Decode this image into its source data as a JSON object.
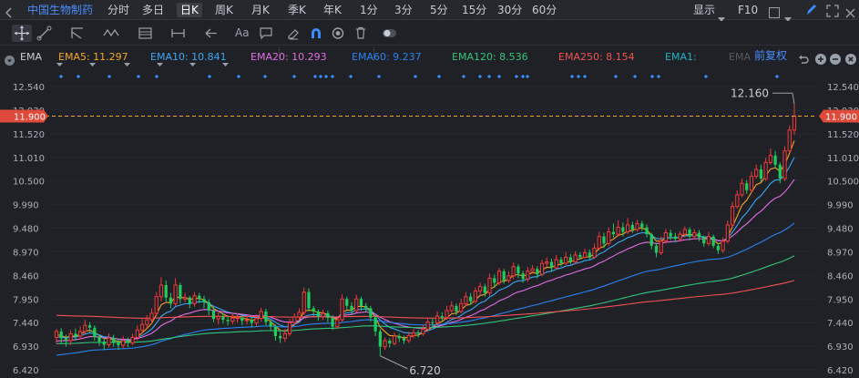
{
  "stock_name": "中国生物制药",
  "periods": [
    "分时",
    "多日",
    "日K",
    "周K",
    "月K",
    "季K",
    "年K",
    "1分",
    "3分",
    "5分",
    "15分",
    "30分",
    "60分"
  ],
  "active_period": "日K",
  "topbar_right": {
    "display_label": "显示",
    "f10_label": "F10"
  },
  "toolbar": {
    "text_label": "Aa"
  },
  "legend": {
    "indicator": "EMA",
    "items": [
      {
        "label": "EMA5: 11.297",
        "color": "#f5a623"
      },
      {
        "label": "EMA10: 10.841",
        "color": "#3ba7f2"
      },
      {
        "label": "EMA20: 10.293",
        "color": "#e26de5"
      },
      {
        "label": "EMA60: 9.237",
        "color": "#2b82f0"
      },
      {
        "label": "EMA120: 8.536",
        "color": "#33c47a"
      },
      {
        "label": "EMA250: 8.154",
        "color": "#f05252"
      },
      {
        "label": "EMA1:",
        "color": "#21b1c2"
      },
      {
        "label": "EMA",
        "color": "#555a63"
      }
    ],
    "adjust_label": "前复权"
  },
  "colors": {
    "up": "#f23a3a",
    "down": "#1fcc5c",
    "price_line": "#f5a623",
    "price_tag": "#e04a3a"
  },
  "chart_data": {
    "type": "candlestick",
    "y_axis_labels": [
      "12.540",
      "12.030",
      "11.520",
      "11.010",
      "10.500",
      "9.990",
      "9.480",
      "8.970",
      "8.460",
      "7.950",
      "7.440",
      "6.930",
      "6.420"
    ],
    "ylim": [
      6.42,
      12.54
    ],
    "current_price": "11.900",
    "annotations": {
      "high": "12.160",
      "low": "6.720"
    },
    "candles": [
      [
        7.12,
        7.25,
        6.99,
        7.3
      ],
      [
        7.25,
        7.1,
        6.98,
        7.32
      ],
      [
        7.1,
        7.05,
        6.92,
        7.18
      ],
      [
        7.05,
        7.2,
        6.95,
        7.28
      ],
      [
        7.2,
        7.15,
        7.05,
        7.31
      ],
      [
        7.15,
        7.25,
        7.08,
        7.36
      ],
      [
        7.25,
        7.38,
        7.2,
        7.5
      ],
      [
        7.38,
        7.33,
        7.22,
        7.45
      ],
      [
        7.33,
        7.13,
        7.05,
        7.38
      ],
      [
        7.13,
        7.03,
        6.94,
        7.18
      ],
      [
        7.03,
        6.96,
        6.85,
        7.1
      ],
      [
        6.96,
        7.11,
        6.9,
        7.21
      ],
      [
        7.11,
        7.0,
        6.92,
        7.18
      ],
      [
        7.0,
        6.95,
        6.85,
        7.08
      ],
      [
        6.95,
        7.05,
        6.89,
        7.15
      ],
      [
        7.05,
        7.0,
        6.91,
        7.12
      ],
      [
        7.0,
        7.12,
        6.95,
        7.2
      ],
      [
        7.12,
        7.28,
        7.05,
        7.38
      ],
      [
        7.28,
        7.4,
        7.2,
        7.52
      ],
      [
        7.4,
        7.5,
        7.32,
        7.6
      ],
      [
        7.5,
        7.64,
        7.42,
        7.75
      ],
      [
        7.64,
        8.0,
        7.58,
        8.1
      ],
      [
        8.0,
        8.25,
        7.9,
        8.42
      ],
      [
        8.25,
        7.98,
        7.9,
        8.35
      ],
      [
        7.98,
        7.85,
        7.75,
        8.08
      ],
      [
        7.85,
        8.25,
        7.8,
        8.4
      ],
      [
        8.25,
        7.95,
        7.85,
        8.3
      ],
      [
        7.95,
        7.98,
        7.88,
        8.08
      ],
      [
        7.98,
        7.85,
        7.75,
        8.02
      ],
      [
        7.85,
        8.02,
        7.78,
        8.1
      ],
      [
        8.02,
        7.95,
        7.86,
        8.08
      ],
      [
        7.95,
        7.88,
        7.75,
        8.02
      ],
      [
        7.88,
        7.7,
        7.6,
        7.94
      ],
      [
        7.7,
        7.52,
        7.45,
        7.78
      ],
      [
        7.52,
        7.57,
        7.4,
        7.66
      ],
      [
        7.57,
        7.5,
        7.42,
        7.64
      ],
      [
        7.5,
        7.47,
        7.38,
        7.58
      ],
      [
        7.47,
        7.54,
        7.4,
        7.62
      ],
      [
        7.54,
        7.55,
        7.44,
        7.65
      ],
      [
        7.55,
        7.48,
        7.38,
        7.6
      ],
      [
        7.48,
        7.5,
        7.4,
        7.58
      ],
      [
        7.5,
        7.43,
        7.34,
        7.56
      ],
      [
        7.43,
        7.53,
        7.36,
        7.62
      ],
      [
        7.53,
        7.68,
        7.46,
        7.76
      ],
      [
        7.68,
        7.45,
        7.38,
        7.74
      ],
      [
        7.45,
        7.35,
        7.28,
        7.5
      ],
      [
        7.35,
        7.15,
        7.05,
        7.4
      ],
      [
        7.15,
        7.1,
        7.0,
        7.24
      ],
      [
        7.1,
        7.2,
        7.02,
        7.3
      ],
      [
        7.2,
        7.44,
        7.15,
        7.52
      ],
      [
        7.44,
        7.56,
        7.38,
        7.64
      ],
      [
        7.56,
        7.66,
        7.5,
        7.75
      ],
      [
        7.66,
        8.1,
        7.6,
        8.2
      ],
      [
        8.1,
        7.75,
        7.68,
        8.18
      ],
      [
        7.75,
        7.68,
        7.58,
        7.8
      ],
      [
        7.68,
        7.57,
        7.48,
        7.72
      ],
      [
        7.57,
        7.64,
        7.5,
        7.72
      ],
      [
        7.64,
        7.54,
        7.45,
        7.7
      ],
      [
        7.54,
        7.35,
        7.28,
        7.6
      ],
      [
        7.35,
        7.5,
        7.3,
        7.58
      ],
      [
        7.5,
        7.95,
        7.45,
        8.05
      ],
      [
        7.95,
        7.8,
        7.72,
        8.0
      ],
      [
        7.8,
        7.7,
        7.62,
        7.88
      ],
      [
        7.7,
        7.95,
        7.66,
        8.04
      ],
      [
        7.95,
        7.8,
        7.7,
        8.0
      ],
      [
        7.8,
        7.75,
        7.68,
        7.86
      ],
      [
        7.75,
        7.55,
        7.46,
        7.8
      ],
      [
        7.55,
        7.25,
        7.15,
        7.62
      ],
      [
        7.25,
        6.92,
        6.72,
        7.3
      ],
      [
        6.92,
        7.05,
        6.85,
        7.12
      ],
      [
        7.05,
        6.99,
        6.9,
        7.1
      ],
      [
        6.99,
        7.15,
        6.95,
        7.22
      ],
      [
        7.15,
        7.1,
        7.02,
        7.2
      ],
      [
        7.1,
        7.05,
        6.98,
        7.16
      ],
      [
        7.05,
        7.16,
        7.0,
        7.24
      ],
      [
        7.16,
        7.22,
        7.1,
        7.3
      ],
      [
        7.22,
        7.2,
        7.12,
        7.28
      ],
      [
        7.2,
        7.3,
        7.15,
        7.38
      ],
      [
        7.3,
        7.45,
        7.24,
        7.55
      ],
      [
        7.45,
        7.43,
        7.35,
        7.52
      ],
      [
        7.43,
        7.58,
        7.38,
        7.68
      ],
      [
        7.58,
        7.55,
        7.48,
        7.66
      ],
      [
        7.55,
        7.7,
        7.5,
        7.8
      ],
      [
        7.7,
        7.8,
        7.65,
        7.9
      ],
      [
        7.8,
        7.68,
        7.6,
        7.85
      ],
      [
        7.68,
        7.85,
        7.64,
        7.95
      ],
      [
        7.85,
        8.0,
        7.8,
        8.1
      ],
      [
        8.0,
        7.9,
        7.82,
        8.08
      ],
      [
        7.9,
        8.12,
        7.85,
        8.2
      ],
      [
        8.12,
        8.22,
        8.05,
        8.3
      ],
      [
        8.22,
        8.08,
        8.0,
        8.28
      ],
      [
        8.08,
        8.4,
        8.02,
        8.5
      ],
      [
        8.4,
        8.3,
        8.2,
        8.48
      ],
      [
        8.3,
        8.55,
        8.25,
        8.62
      ],
      [
        8.55,
        8.35,
        8.28,
        8.6
      ],
      [
        8.35,
        8.45,
        8.3,
        8.55
      ],
      [
        8.45,
        8.65,
        8.38,
        8.74
      ],
      [
        8.65,
        8.5,
        8.4,
        8.7
      ],
      [
        8.5,
        8.38,
        8.3,
        8.56
      ],
      [
        8.38,
        8.55,
        8.32,
        8.64
      ],
      [
        8.55,
        8.6,
        8.5,
        8.68
      ],
      [
        8.6,
        8.48,
        8.4,
        8.66
      ],
      [
        8.48,
        8.72,
        8.44,
        8.8
      ],
      [
        8.72,
        8.75,
        8.65,
        8.85
      ],
      [
        8.75,
        8.62,
        8.55,
        8.82
      ],
      [
        8.62,
        8.8,
        8.58,
        8.9
      ],
      [
        8.8,
        8.72,
        8.65,
        8.86
      ],
      [
        8.72,
        8.85,
        8.68,
        8.96
      ],
      [
        8.85,
        8.75,
        8.7,
        8.92
      ],
      [
        8.75,
        8.9,
        8.7,
        8.98
      ],
      [
        8.9,
        8.85,
        8.8,
        8.96
      ],
      [
        8.85,
        8.95,
        8.82,
        9.04
      ],
      [
        8.95,
        8.85,
        8.8,
        9.02
      ],
      [
        8.85,
        9.05,
        8.82,
        9.15
      ],
      [
        9.05,
        9.3,
        9.0,
        9.4
      ],
      [
        9.3,
        9.15,
        9.05,
        9.38
      ],
      [
        9.15,
        9.4,
        9.1,
        9.5
      ],
      [
        9.4,
        9.35,
        9.28,
        9.58
      ],
      [
        9.35,
        9.5,
        9.3,
        9.65
      ],
      [
        9.5,
        9.4,
        9.3,
        9.6
      ],
      [
        9.4,
        9.55,
        9.35,
        9.7
      ],
      [
        9.55,
        9.45,
        9.38,
        9.62
      ],
      [
        9.45,
        9.58,
        9.4,
        9.66
      ],
      [
        9.58,
        9.5,
        9.42,
        9.64
      ],
      [
        9.5,
        9.35,
        9.28,
        9.56
      ],
      [
        9.35,
        9.1,
        9.02,
        9.38
      ],
      [
        9.1,
        8.95,
        8.85,
        9.15
      ],
      [
        8.95,
        9.2,
        8.9,
        9.3
      ],
      [
        9.2,
        9.38,
        9.15,
        9.46
      ],
      [
        9.38,
        9.3,
        9.22,
        9.45
      ],
      [
        9.3,
        9.25,
        9.18,
        9.38
      ],
      [
        9.25,
        9.35,
        9.2,
        9.42
      ],
      [
        9.35,
        9.45,
        9.28,
        9.52
      ],
      [
        9.45,
        9.3,
        9.22,
        9.5
      ],
      [
        9.3,
        9.38,
        9.25,
        9.46
      ],
      [
        9.38,
        9.28,
        9.2,
        9.44
      ],
      [
        9.28,
        9.15,
        9.08,
        9.32
      ],
      [
        9.15,
        9.3,
        9.1,
        9.4
      ],
      [
        9.3,
        9.1,
        9.05,
        9.34
      ],
      [
        9.1,
        9.0,
        8.92,
        9.16
      ],
      [
        9.0,
        9.2,
        8.95,
        9.28
      ],
      [
        9.2,
        9.55,
        9.15,
        9.65
      ],
      [
        9.55,
        9.95,
        9.5,
        10.05
      ],
      [
        9.95,
        10.2,
        9.9,
        10.3
      ],
      [
        10.2,
        10.45,
        10.15,
        10.55
      ],
      [
        10.45,
        10.3,
        10.22,
        10.52
      ],
      [
        10.3,
        10.6,
        10.25,
        10.7
      ],
      [
        10.6,
        10.75,
        10.55,
        10.85
      ],
      [
        10.75,
        10.55,
        10.48,
        10.85
      ],
      [
        10.55,
        10.9,
        10.5,
        11.0
      ],
      [
        10.9,
        11.05,
        10.85,
        11.2
      ],
      [
        11.05,
        10.85,
        10.78,
        11.15
      ],
      [
        10.85,
        10.55,
        10.45,
        10.9
      ],
      [
        10.55,
        11.15,
        10.5,
        11.25
      ],
      [
        11.15,
        11.6,
        11.1,
        11.7
      ],
      [
        11.6,
        11.9,
        11.5,
        12.16
      ]
    ]
  }
}
